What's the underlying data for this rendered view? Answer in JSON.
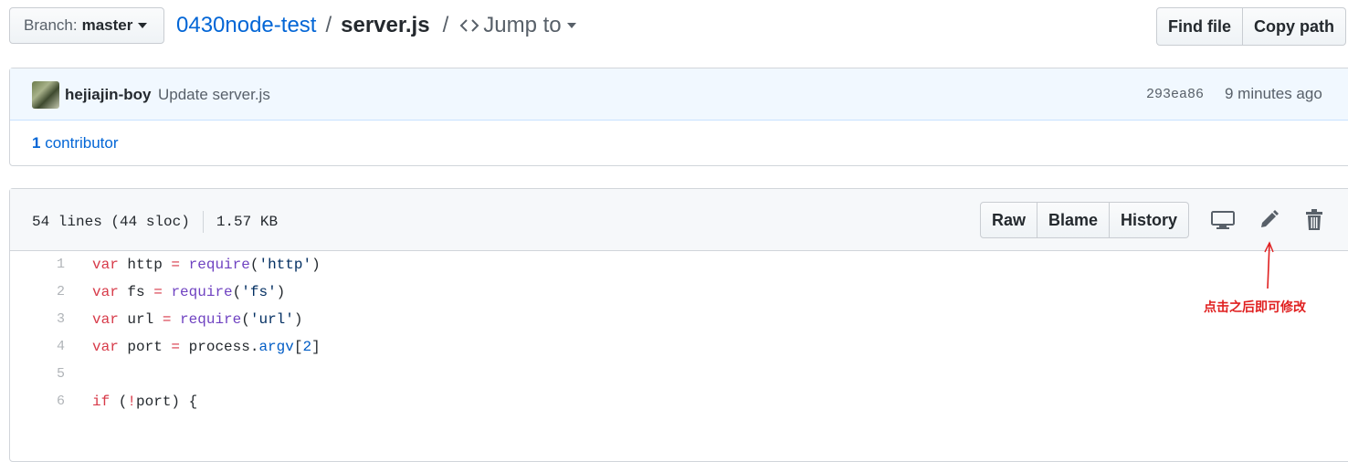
{
  "header": {
    "branch_label": "Branch:",
    "branch_value": "master",
    "repo": "0430node-test",
    "separator": "/",
    "file": "server.js",
    "jump_to": "Jump to",
    "find_file": "Find file",
    "copy_path": "Copy path"
  },
  "commit": {
    "author": "hejiajin-boy",
    "message": "Update server.js",
    "sha": "293ea86",
    "time": "9 minutes ago",
    "contributors_count": "1",
    "contributors_label": "contributor"
  },
  "file": {
    "lines_info": "54 lines (44 sloc)",
    "size": "1.57 KB",
    "buttons": {
      "raw": "Raw",
      "blame": "Blame",
      "history": "History"
    },
    "icons": [
      "desktop-icon",
      "pencil-icon",
      "trash-icon"
    ]
  },
  "code": [
    {
      "n": "1",
      "text": "var http = require('http')"
    },
    {
      "n": "2",
      "text": "var fs = require('fs')"
    },
    {
      "n": "3",
      "text": "var url = require('url')"
    },
    {
      "n": "4",
      "text": "var port = process.argv[2]"
    },
    {
      "n": "5",
      "text": ""
    },
    {
      "n": "6",
      "text": "if (!port) {"
    }
  ],
  "annotation": {
    "text": "点击之后即可修改",
    "color": "#e02020"
  },
  "colors": {
    "link": "#0366d6",
    "keyword": "#d73a49",
    "function": "#6f42c1",
    "string": "#032f62",
    "number": "#005cc5"
  }
}
